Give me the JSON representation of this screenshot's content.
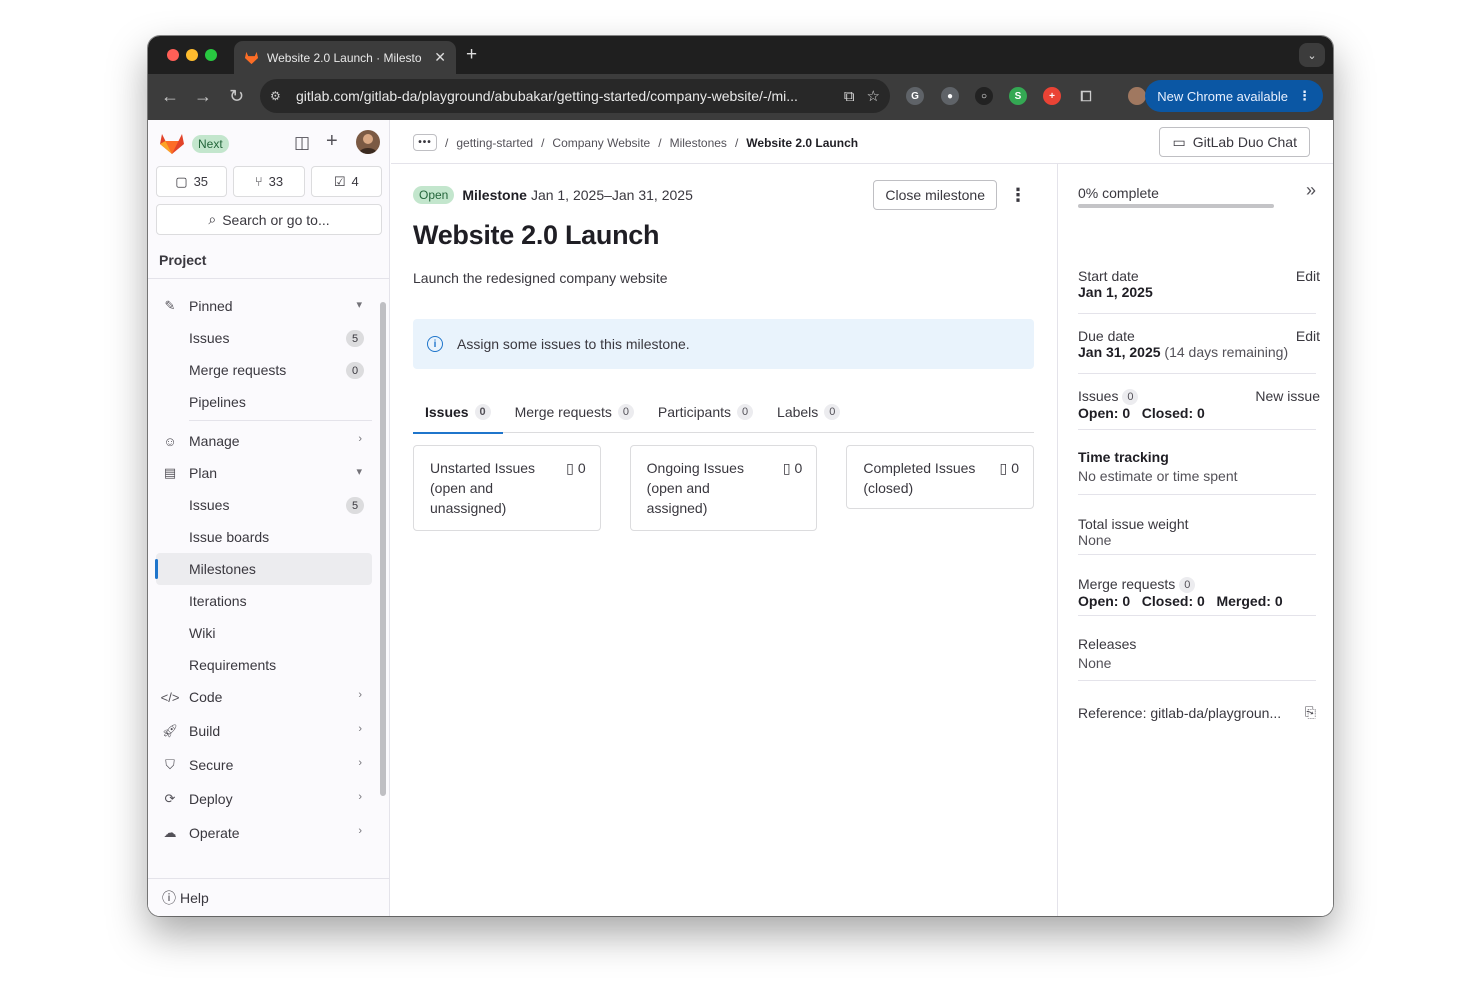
{
  "browser": {
    "tab_title": "Website 2.0 Launch · Milesto",
    "url": "gitlab.com/gitlab-da/playground/abubakar/getting-started/company-website/-/mi...",
    "update_label": "New Chrome available"
  },
  "sidebar": {
    "next_badge": "Next",
    "counts": [
      {
        "icon": "issues-icon",
        "value": "35"
      },
      {
        "icon": "merge-request-icon",
        "value": "33"
      },
      {
        "icon": "todo-icon",
        "value": "4"
      }
    ],
    "search_label": "Search or go to...",
    "section_title": "Project",
    "pinned": "Pinned",
    "pinned_items": [
      {
        "label": "Issues",
        "count": "5"
      },
      {
        "label": "Merge requests",
        "count": "0"
      },
      {
        "label": "Pipelines"
      }
    ],
    "manage": "Manage",
    "plan": "Plan",
    "plan_items": [
      {
        "label": "Issues",
        "count": "5"
      },
      {
        "label": "Issue boards"
      },
      {
        "label": "Milestones"
      },
      {
        "label": "Iterations"
      },
      {
        "label": "Wiki"
      },
      {
        "label": "Requirements"
      }
    ],
    "groups": [
      "Code",
      "Build",
      "Secure",
      "Deploy",
      "Operate"
    ],
    "help": "Help"
  },
  "breadcrumbs": [
    "getting-started",
    "Company Website",
    "Milestones",
    "Website 2.0 Launch"
  ],
  "duo_chat": "GitLab Duo Chat",
  "milestone": {
    "status": "Open",
    "label": "Milestone",
    "dates": "Jan 1, 2025–Jan 31, 2025",
    "close_button": "Close milestone",
    "title": "Website 2.0 Launch",
    "description": "Launch the redesigned company website",
    "alert": "Assign some issues to this milestone."
  },
  "tabs": [
    {
      "label": "Issues",
      "count": "0"
    },
    {
      "label": "Merge requests",
      "count": "0"
    },
    {
      "label": "Participants",
      "count": "0"
    },
    {
      "label": "Labels",
      "count": "0"
    }
  ],
  "cards": [
    {
      "title": "Unstarted Issues (open and unassigned)",
      "count": "0"
    },
    {
      "title": "Ongoing Issues (open and assigned)",
      "count": "0"
    },
    {
      "title": "Completed Issues (closed)",
      "count": "0"
    }
  ],
  "right_sidebar": {
    "percent": "0% complete",
    "progress_fraction": 0,
    "start_label": "Start date",
    "start_value": "Jan 1, 2025",
    "due_label": "Due date",
    "due_value": "Jan 31, 2025",
    "due_remaining": "(14 days remaining)",
    "edit": "Edit",
    "issues_label": "Issues",
    "issues_count": "0",
    "new_issue": "New issue",
    "issues_open": "Open: 0",
    "issues_closed": "Closed: 0",
    "time_label": "Time tracking",
    "time_value": "No estimate or time spent",
    "weight_label": "Total issue weight",
    "weight_value": "None",
    "mr_label": "Merge requests",
    "mr_count": "0",
    "mr_open": "Open: 0",
    "mr_closed": "Closed: 0",
    "mr_merged": "Merged: 0",
    "releases_label": "Releases",
    "releases_value": "None",
    "reference": "Reference: gitlab-da/playgroun..."
  }
}
